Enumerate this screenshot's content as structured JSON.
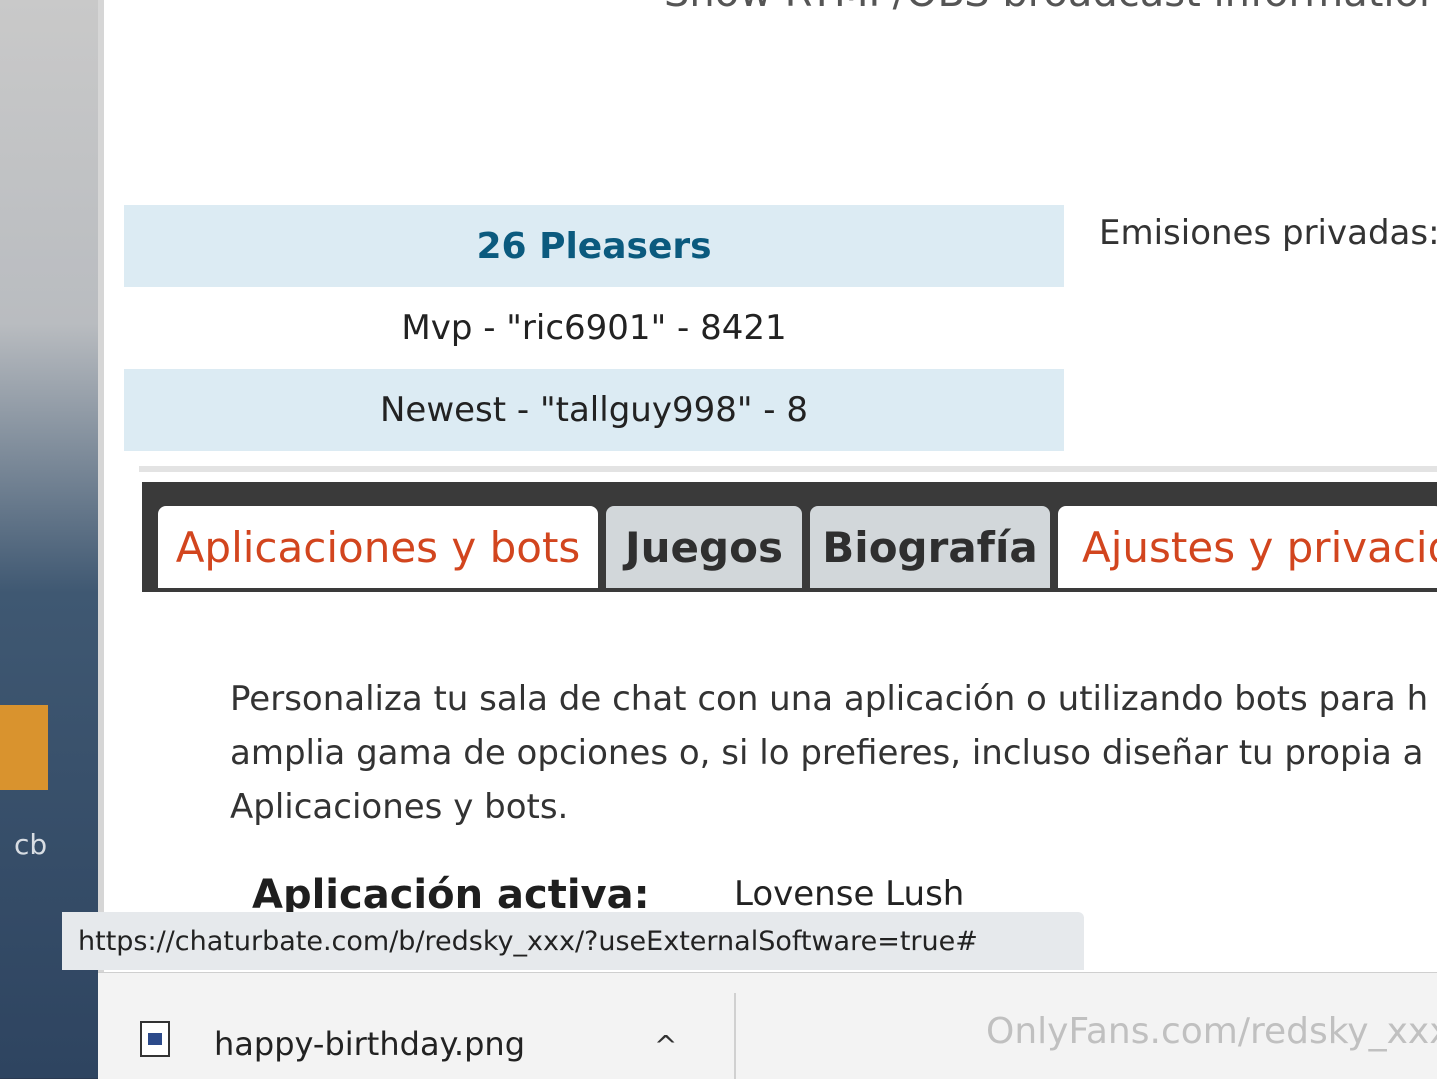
{
  "desktop": {
    "label": "cb"
  },
  "header": {
    "fragment": "Show RTMP/OBS broadcast information"
  },
  "stats": {
    "title": "26 Pleasers",
    "mvp": "Mvp - \"ric6901\" - 8421",
    "newest": "Newest - \"tallguy998\" - 8"
  },
  "private_shows": "Emisiones privadas: (",
  "tabs": [
    {
      "label": "Aplicaciones y bots"
    },
    {
      "label": "Juegos"
    },
    {
      "label": "Biografía"
    },
    {
      "label": "Ajustes y privacida"
    }
  ],
  "apps": {
    "line1": "Personaliza tu sala de chat con una aplicación o utilizando bots para h",
    "line2": "amplia gama de opciones o, si lo prefieres, incluso diseñar tu propia a",
    "line3": "Aplicaciones y bots.",
    "active_label": "Aplicación activa:",
    "active_value": "Lovense Lush"
  },
  "statusbar": {
    "url": "https://chaturbate.com/b/redsky_xxx/?useExternalSoftware=true#"
  },
  "downloads": {
    "filename": "happy-birthday.png",
    "chevron": "^"
  },
  "watermark": {
    "text": "OnlyFans.com/redsky_xxx"
  },
  "colors": {
    "tab_active": "#d2451e",
    "stat_title": "#0b5a7e",
    "row_highlight": "#dcebf3"
  }
}
